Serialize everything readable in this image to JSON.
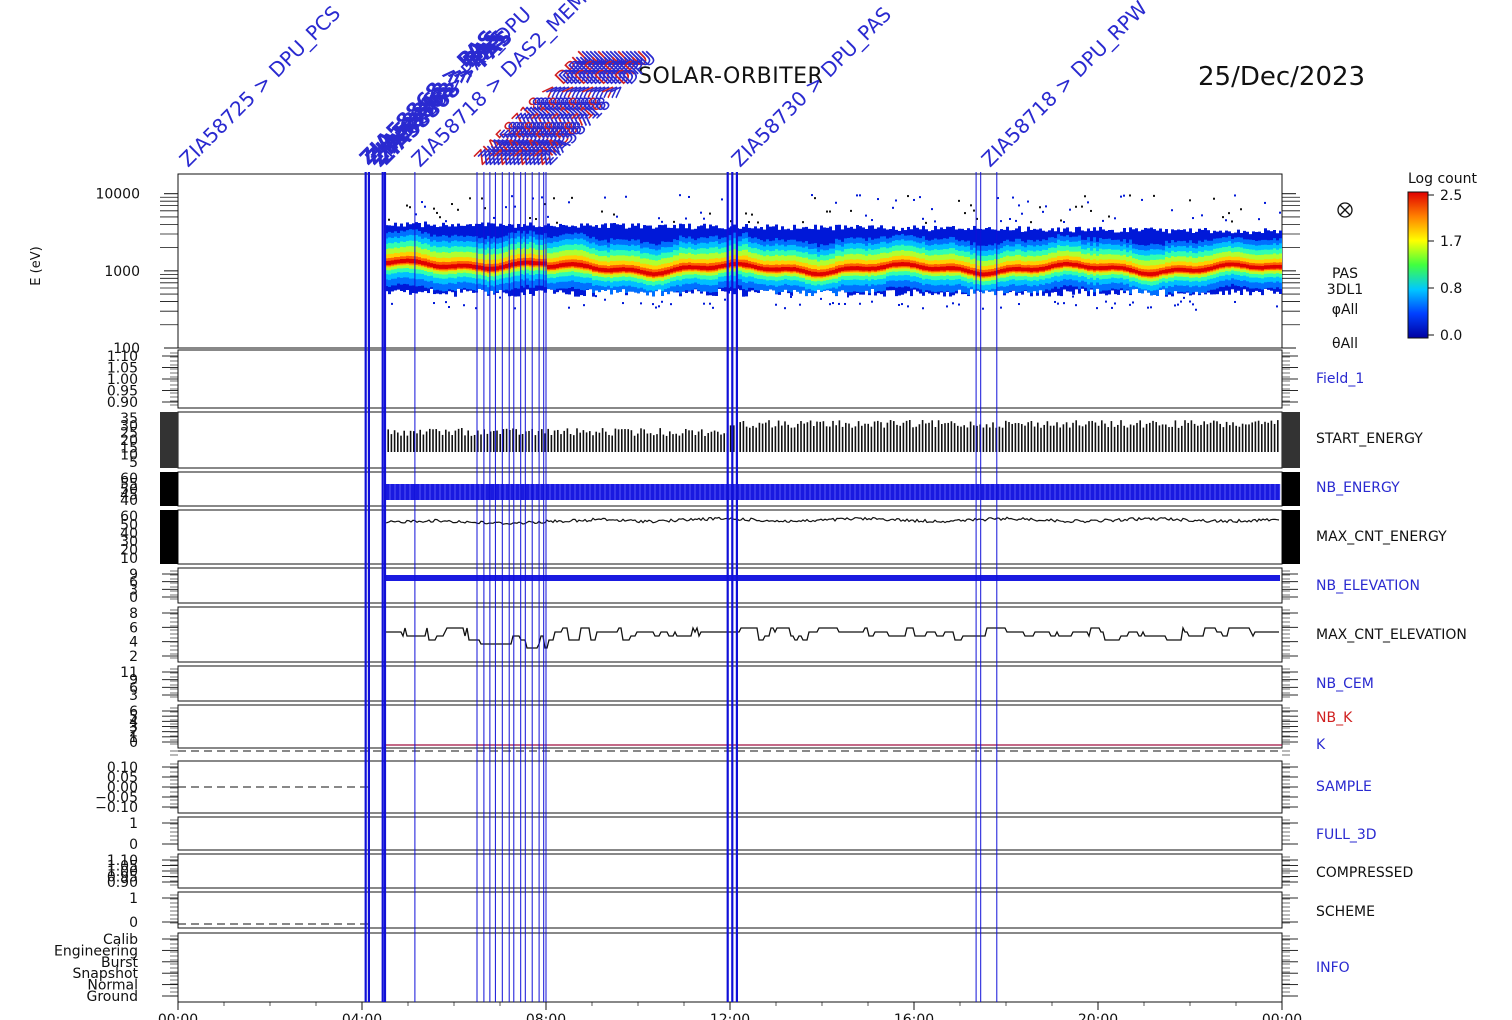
{
  "header": {
    "mission": "SOLAR-ORBITER",
    "date": "25/Dec/2023"
  },
  "colorbar": {
    "title": "Log count",
    "ticks": [
      "2.5",
      "1.7",
      "0.8",
      "0.0"
    ],
    "colors": [
      "#e00000",
      "#ff8000",
      "#ffff00",
      "#40ff40",
      "#00c8ff",
      "#0040ff",
      "#0000a0"
    ]
  },
  "chart_data": {
    "type": "heatmap",
    "x_ticks": [
      "00:00",
      "04:00",
      "08:00",
      "12:00",
      "16:00",
      "20:00",
      "00:00"
    ],
    "x_range_hours": [
      0,
      24
    ],
    "spectrogram": {
      "ylabel": "E (eV)",
      "y_ticks": [
        "10000",
        "1000",
        "100"
      ],
      "ylim": [
        100,
        18000
      ],
      "scale": "log",
      "data_start_hour": 4.5,
      "right_labels": [
        "PAS",
        "3DL1",
        "φAll",
        "θAll"
      ]
    },
    "event_lines_hours": [
      4.08,
      4.15,
      4.45,
      4.5,
      5.15,
      6.5,
      6.65,
      6.78,
      6.9,
      7.05,
      7.2,
      7.3,
      7.45,
      7.55,
      7.7,
      7.85,
      7.95,
      8.0,
      11.95,
      12.05,
      12.15,
      17.35,
      17.45,
      17.8
    ],
    "event_labels": [
      "ZIA58725 > DPU_PCS",
      "ZIA58868 > PAS_DPU",
      "ZIA58718 > DAS2_MEM",
      "ZIA58730 > DPU_PAS",
      "ZIA58718 > DPU_RPW"
    ],
    "panels": [
      {
        "name": "Field_1",
        "color": "#2a2ad0",
        "y_ticks": [
          "1.10",
          "1.05",
          "1.00",
          "0.95",
          "0.90"
        ]
      },
      {
        "name": "START_ENERGY",
        "color": "#111111",
        "y_ticks": [
          "35",
          "30",
          "25",
          "20",
          "15",
          "10",
          "5"
        ]
      },
      {
        "name": "NB_ENERGY",
        "color": "#2a2ad0",
        "y_ticks": [
          "60",
          "55",
          "50",
          "45",
          "40"
        ]
      },
      {
        "name": "MAX_CNT_ENERGY",
        "color": "#111111",
        "y_ticks": [
          "60",
          "50",
          "40",
          "30",
          "20",
          "10"
        ]
      },
      {
        "name": "NB_ELEVATION",
        "color": "#2a2ad0",
        "y_ticks": [
          "9",
          "6",
          "3",
          "0"
        ]
      },
      {
        "name": "MAX_CNT_ELEVATION",
        "color": "#111111",
        "y_ticks": [
          "8",
          "6",
          "4",
          "2"
        ]
      },
      {
        "name": "NB_CEM",
        "color": "#2a2ad0",
        "y_ticks": [
          "11",
          "9",
          "6",
          "3"
        ]
      },
      {
        "name": "NB_K",
        "color": "#d02020",
        "y_ticks": [
          "6",
          "5",
          "4",
          "3",
          "2",
          "1",
          "0"
        ]
      },
      {
        "name": "K",
        "color": "#2a2ad0",
        "y_ticks": []
      },
      {
        "name": "SAMPLE",
        "color": "#2a2ad0",
        "y_ticks": [
          "0.10",
          "0.05",
          "0.00",
          "−0.05",
          "−0.10"
        ]
      },
      {
        "name": "FULL_3D",
        "color": "#2a2ad0",
        "y_ticks": [
          "1",
          "0"
        ]
      },
      {
        "name": "COMPRESSED",
        "color": "#111111",
        "y_ticks": [
          "1.10",
          "1.05",
          "1.00",
          "0.95",
          "0.90"
        ]
      },
      {
        "name": "SCHEME",
        "color": "#111111",
        "y_ticks": [
          "1",
          "0"
        ]
      },
      {
        "name": "INFO",
        "color": "#2a2ad0",
        "y_ticks": [
          "Calib",
          "Engineering",
          "Burst",
          "Snapshot",
          "Normal",
          "Ground"
        ]
      }
    ]
  }
}
